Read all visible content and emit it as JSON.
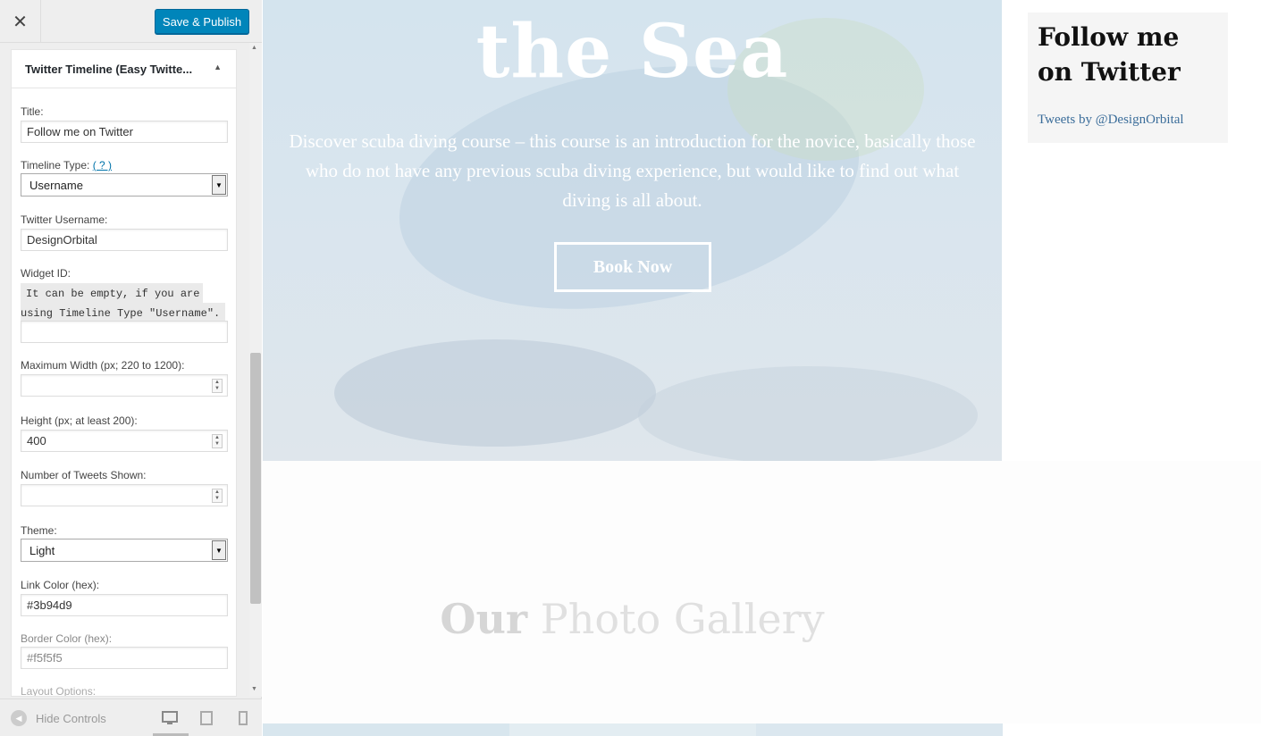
{
  "customizer": {
    "close_icon": "close-icon",
    "publish_label": "Save & Publish",
    "panel_title": "Twitter Timeline (Easy Twitte...",
    "fields": {
      "title_label": "Title:",
      "title_value": "Follow me on Twitter",
      "timeline_type_label": "Timeline Type:",
      "timeline_type_help": "( ? )",
      "timeline_type_value": "Username",
      "username_label": "Twitter Username:",
      "username_value": "DesignOrbital",
      "widget_id_label": "Widget ID:",
      "widget_id_note_line1": "It can be empty, if you are",
      "widget_id_note_line2": "using Timeline Type \"Username\".",
      "widget_id_value": "",
      "max_width_label": "Maximum Width (px; 220 to 1200):",
      "max_width_value": "",
      "height_label": "Height (px; at least 200):",
      "height_value": "400",
      "tweets_label": "Number of Tweets Shown:",
      "tweets_value": "",
      "theme_label": "Theme:",
      "theme_value": "Light",
      "link_color_label": "Link Color (hex):",
      "link_color_value": "#3b94d9",
      "border_color_label": "Border Color (hex):",
      "border_color_value": "#f5f5f5",
      "layout_options_label": "Layout Options:"
    },
    "hide_controls_label": "Hide Controls",
    "devices": [
      "desktop-icon",
      "tablet-icon",
      "mobile-icon"
    ]
  },
  "preview": {
    "hero_title": "the Sea",
    "hero_text": "Discover scuba diving course – this course is an introduction for the novice, basically those who do not have any previous scuba diving experience, but would like to find out what diving is all about.",
    "book_button": "Book Now",
    "gallery_title_bold": "Our",
    "gallery_title_rest": " Photo Gallery",
    "widget_title": "Follow me on Twitter",
    "widget_link": "Tweets by @DesignOrbital"
  },
  "colors": {
    "accent": "#0085ba",
    "link": "#3b94d9",
    "widget_link": "#3b6d9a"
  }
}
